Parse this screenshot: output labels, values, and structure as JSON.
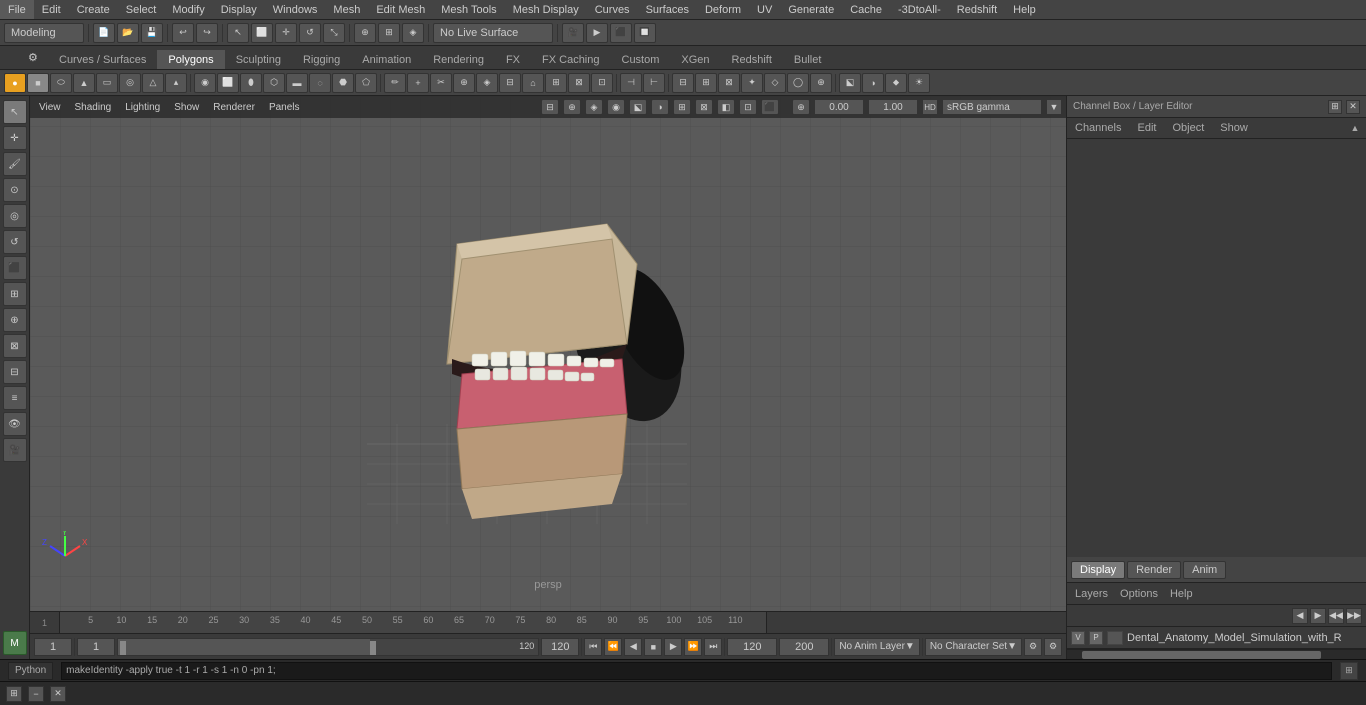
{
  "menu": {
    "items": [
      "File",
      "Edit",
      "Create",
      "Select",
      "Modify",
      "Display",
      "Windows",
      "Mesh",
      "Edit Mesh",
      "Mesh Tools",
      "Mesh Display",
      "Curves",
      "Surfaces",
      "Deform",
      "UV",
      "Generate",
      "Cache",
      "-3DtoAll-",
      "Redshift",
      "Help"
    ]
  },
  "toolbar1": {
    "mode_label": "Modeling",
    "no_live_surface": "No Live Surface"
  },
  "tabs": {
    "items": [
      "Curves / Surfaces",
      "Polygons",
      "Sculpting",
      "Rigging",
      "Animation",
      "Rendering",
      "FX",
      "FX Caching",
      "Custom",
      "XGen",
      "Redshift",
      "Bullet"
    ],
    "active": "Polygons"
  },
  "viewport": {
    "label": "persp",
    "view_menu": "View",
    "shading_menu": "Shading",
    "lighting_menu": "Lighting",
    "show_menu": "Show",
    "renderer_menu": "Renderer",
    "panels_menu": "Panels",
    "exposure": "0.00",
    "gamma": "1.00",
    "color_space": "sRGB gamma"
  },
  "channel_box": {
    "title": "Channel Box / Layer Editor",
    "tabs": [
      "Channels",
      "Edit",
      "Object",
      "Show"
    ],
    "display_tabs": [
      "Display",
      "Render",
      "Anim"
    ],
    "active_display_tab": "Display",
    "layer_menus": [
      "Layers",
      "Options",
      "Help"
    ],
    "layer_name": "Dental_Anatomy_Model_Simulation_with_R",
    "layer_v": "V",
    "layer_p": "P"
  },
  "timeline": {
    "ticks": [
      "5",
      "10",
      "15",
      "20",
      "25",
      "30",
      "35",
      "40",
      "45",
      "50",
      "55",
      "60",
      "65",
      "70",
      "75",
      "80",
      "85",
      "90",
      "95",
      "100",
      "105",
      "110"
    ],
    "end_tick": "1"
  },
  "playback": {
    "current_frame": "1",
    "frame_start": "1",
    "inner_frame_start": "1",
    "inner_frame_end": "120",
    "frame_range_end": "120",
    "anim_end": "200",
    "anim_layer": "No Anim Layer",
    "char_set": "No Character Set",
    "play_buttons": [
      "⏮",
      "⏮",
      "◀",
      "◀",
      "▶",
      "▶▶",
      "⏭",
      "⏭"
    ]
  },
  "status_bar": {
    "python_label": "Python",
    "command": "makeIdentity -apply true -t 1 -r 1 -s 1 -n 0 -pn 1;"
  },
  "icons": {
    "close": "✕",
    "minimize": "−",
    "settings": "⚙",
    "arrow_left": "◀",
    "arrow_right": "▶",
    "layers_scroll_left": "◀",
    "layers_scroll_right": "▶"
  }
}
